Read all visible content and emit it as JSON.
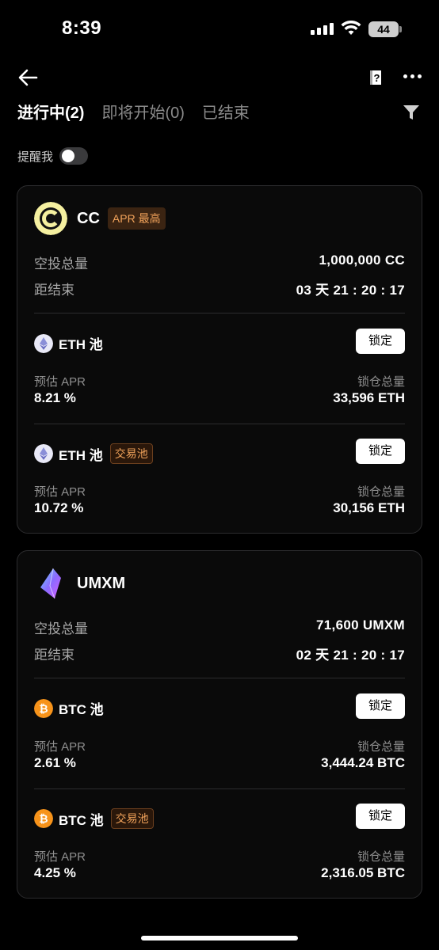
{
  "status_bar": {
    "time": "8:39",
    "battery": "44"
  },
  "tabs": [
    {
      "label": "进行中(2)"
    },
    {
      "label": "即将开始(0)"
    },
    {
      "label": "已结束"
    }
  ],
  "remind_label": "提醒我",
  "colors": {
    "orange": "#f0a25a",
    "eth": "#8b8fd8",
    "btc": "#f7931a",
    "cc": "#f5f0a0"
  },
  "projects": [
    {
      "name": "CC",
      "tag": "APR 最高",
      "airdrop_label": "空投总量",
      "airdrop_value": "1,000,000 CC",
      "end_label": "距结束",
      "end_value": "03 天 21 : 20 : 17",
      "pools": [
        {
          "name": "ETH 池",
          "tag": "",
          "lock_label": "锁定",
          "apr_label": "预估 APR",
          "apr": "8.21 %",
          "total_label": "锁仓总量",
          "total": "33,596 ETH"
        },
        {
          "name": "ETH 池",
          "tag": "交易池",
          "lock_label": "锁定",
          "apr_label": "预估 APR",
          "apr": "10.72 %",
          "total_label": "锁仓总量",
          "total": "30,156 ETH"
        }
      ]
    },
    {
      "name": "UMXM",
      "tag": "",
      "airdrop_label": "空投总量",
      "airdrop_value": "71,600 UMXM",
      "end_label": "距结束",
      "end_value": "02 天 21 : 20 : 17",
      "pools": [
        {
          "name": "BTC 池",
          "tag": "",
          "lock_label": "锁定",
          "apr_label": "预估 APR",
          "apr": "2.61 %",
          "total_label": "锁仓总量",
          "total": "3,444.24 BTC"
        },
        {
          "name": "BTC 池",
          "tag": "交易池",
          "lock_label": "锁定",
          "apr_label": "预估 APR",
          "apr": "4.25 %",
          "total_label": "锁仓总量",
          "total": "2,316.05 BTC"
        }
      ]
    }
  ]
}
